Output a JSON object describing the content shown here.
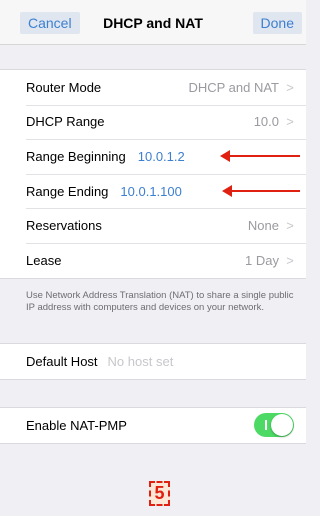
{
  "navbar": {
    "cancel_label": "Cancel",
    "title": "DHCP and NAT",
    "done_label": "Done"
  },
  "settings": {
    "router_mode": {
      "label": "Router Mode",
      "value": "DHCP and NAT"
    },
    "dhcp_range": {
      "label": "DHCP Range",
      "value": "10.0"
    },
    "range_beginning": {
      "label": "Range Beginning",
      "value": "10.0.1.2"
    },
    "range_ending": {
      "label": "Range Ending",
      "value": "10.0.1.100"
    },
    "reservations": {
      "label": "Reservations",
      "value": "None"
    },
    "lease": {
      "label": "Lease",
      "value": "1 Day"
    }
  },
  "nat_note": "Use Network Address Translation (NAT) to share a single public IP address with computers and devices on your network.",
  "default_host": {
    "label": "Default Host",
    "placeholder": "No host set"
  },
  "nat_pmp": {
    "label": "Enable NAT-PMP",
    "enabled": true,
    "toggle_mark": "I"
  },
  "annotation": {
    "step": "5",
    "color": "#e02010"
  },
  "colors": {
    "accent": "#3d7fd1",
    "toggle_on": "#4cd964",
    "background": "#efeff4"
  },
  "icons": {
    "chevron": "chevron-right-icon"
  }
}
